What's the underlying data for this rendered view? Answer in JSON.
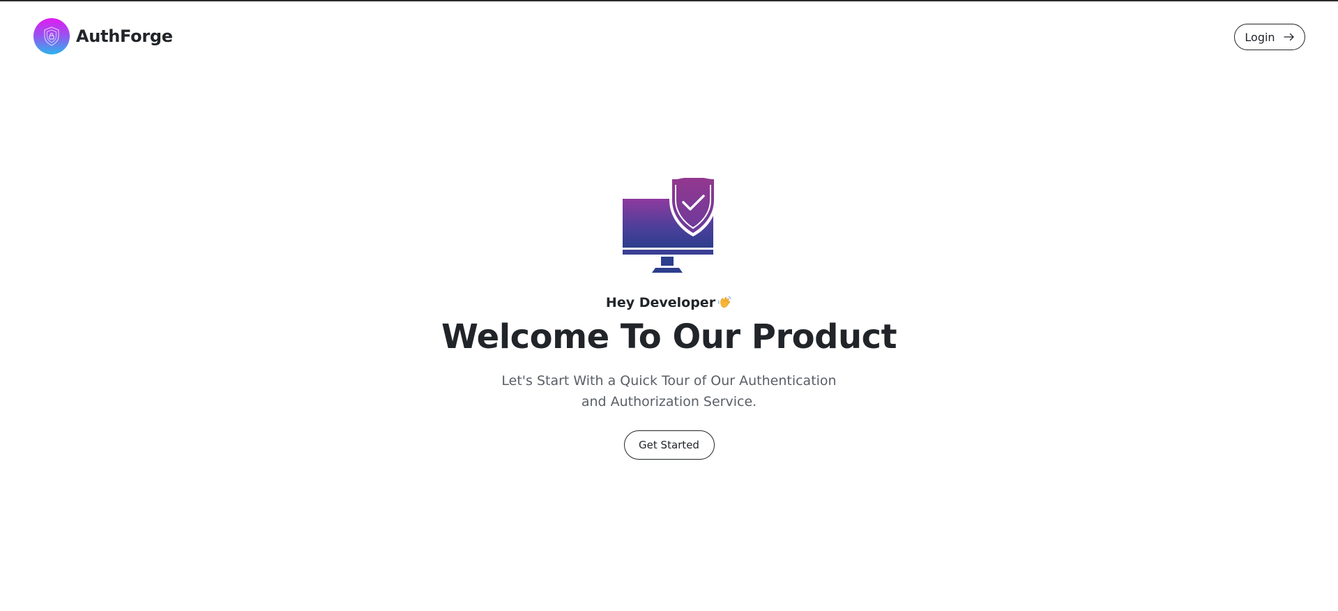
{
  "navbar": {
    "brand_name": "AuthForge",
    "login_label": "Login",
    "logo_icon": "shield-lock-icon",
    "login_icon": "arrow-right-icon"
  },
  "hero": {
    "illustration_icon": "monitor-shield-check-icon",
    "greeting": "Hey Developer",
    "greeting_icon": "waving-hand-icon",
    "headline": "Welcome To Our Product",
    "subtitle": "Let's Start With a Quick Tour of Our Authentication and Authorization Service.",
    "cta_label": "Get Started"
  },
  "colors": {
    "text": "#212529",
    "muted_text": "#5a5f66",
    "logo_gradient": [
      "#e11cf0",
      "#2cb4ec"
    ],
    "illustration_gradient": [
      "#8e3a9e",
      "#4b3f9a",
      "#2c3e8c"
    ]
  }
}
